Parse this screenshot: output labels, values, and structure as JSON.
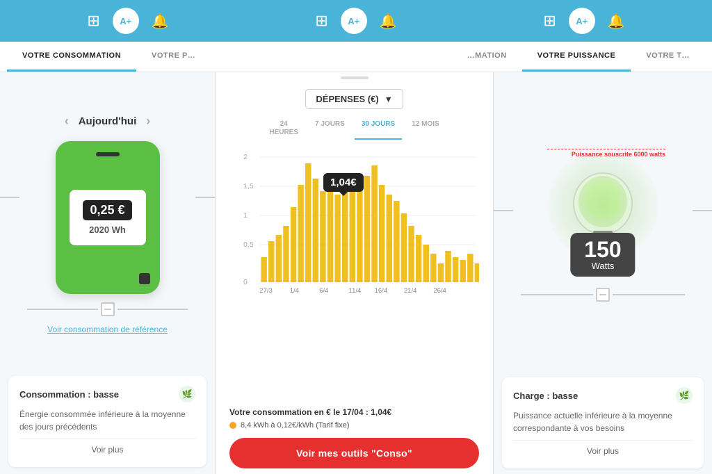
{
  "nav": {
    "groups": [
      {
        "icon_label": "A+",
        "type": "circle"
      },
      {
        "icon_label": "A+",
        "type": "circle"
      },
      {
        "icon_label": "A+",
        "type": "circle"
      }
    ]
  },
  "tabs": [
    {
      "label": "VOTRE CONSOMMATION",
      "active": true
    },
    {
      "label": "VOTRE P…",
      "active": false
    },
    {
      "label": "…MATION",
      "active": false
    },
    {
      "label": "VOTRE PUISSANCE",
      "active": true
    },
    {
      "label": "VOTRE T…",
      "active": false
    }
  ],
  "left_panel": {
    "date_nav": {
      "prev_label": "‹",
      "next_label": "›",
      "current": "Aujourd'hui"
    },
    "device": {
      "value": "0,25 €",
      "wh": "2020 Wh"
    },
    "ref_link": "Voir consommation de référence",
    "info_card": {
      "title": "Consommation : basse",
      "text": "Énergie consommée inférieure à la moyenne des jours précédents",
      "eco_icon": "🌿",
      "voir_plus": "Voir plus"
    }
  },
  "center_panel": {
    "dropdown_label": "DÉPENSES (€)",
    "time_tabs": [
      {
        "label": "24\nHEURES",
        "active": false
      },
      {
        "label": "7 JOURS",
        "active": false
      },
      {
        "label": "30 JOURS",
        "active": true
      },
      {
        "label": "12 MOIS",
        "active": false
      }
    ],
    "chart": {
      "y_labels": [
        "2",
        "1,5",
        "1",
        "0,5",
        "0"
      ],
      "x_labels": [
        "27/3",
        "1/4",
        "6/4",
        "11/4",
        "16/4",
        "21/4",
        "26/4"
      ],
      "tooltip_value": "1,04€",
      "bars": [
        0.4,
        0.65,
        0.75,
        0.9,
        1.2,
        1.55,
        1.9,
        1.65,
        1.45,
        1.5,
        1.4,
        1.6,
        1.45,
        1.55,
        1.7,
        1.85,
        1.55,
        1.4,
        1.3,
        1.1,
        0.9,
        0.75,
        0.6,
        0.45,
        0.3,
        0.5,
        0.4,
        0.35,
        0.45,
        0.3
      ]
    },
    "conso_line": "Votre consommation en € le 17/04 : ",
    "conso_value": "1,04€",
    "tarif_line": "8,4 kWh à 0,12€/kWh (Tarif fixe)",
    "cta_label": "Voir mes outils \"Conso\""
  },
  "right_panel": {
    "watts": "150",
    "watts_label": "Watts",
    "power_label": "Puissance souscrite\n6000 watts",
    "info_card": {
      "title": "Charge : basse",
      "text": "Puissance actuelle inférieure à la moyenne correspondante à vos besoins",
      "eco_icon": "🌿",
      "voir_plus": "Voir plus"
    }
  },
  "colors": {
    "primary_blue": "#4ab4d8",
    "green": "#5bbf44",
    "yellow_bar": "#f0c020",
    "red": "#e63030",
    "dark": "#333333",
    "light_bg": "#f5f8fa"
  }
}
